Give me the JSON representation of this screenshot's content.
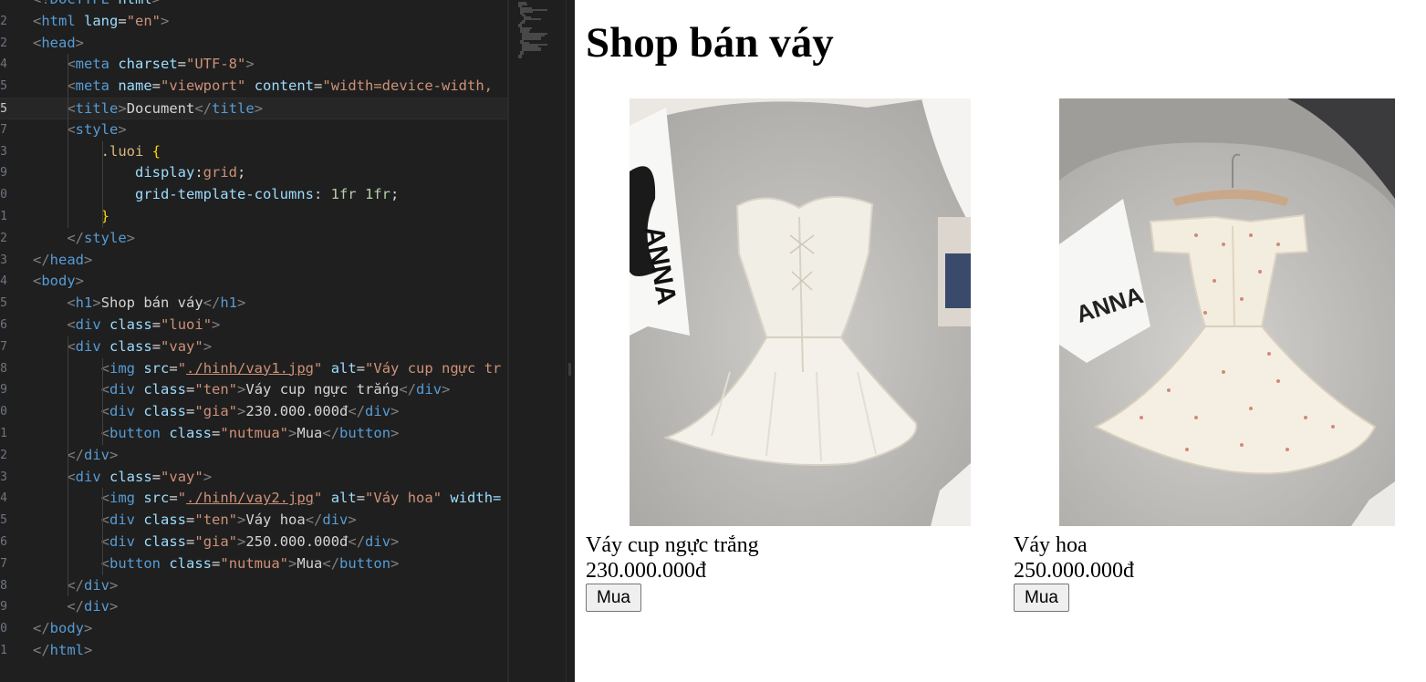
{
  "editor": {
    "lines": [
      {
        "n": "",
        "tokens": [
          [
            "b",
            "<!"
          ],
          [
            "tag",
            "DOCTYPE"
          ],
          [
            "txt",
            " "
          ],
          [
            "attr",
            "html"
          ],
          [
            "b",
            ">"
          ]
        ]
      },
      {
        "n": "2",
        "tokens": [
          [
            "b",
            "<"
          ],
          [
            "tag",
            "html"
          ],
          [
            "txt",
            " "
          ],
          [
            "attr",
            "lang"
          ],
          [
            "txt",
            "="
          ],
          [
            "str",
            "\"en\""
          ],
          [
            "b",
            ">"
          ]
        ]
      },
      {
        "n": "2",
        "tokens": [
          [
            "b",
            "<"
          ],
          [
            "tag",
            "head"
          ],
          [
            "b",
            ">"
          ]
        ]
      },
      {
        "n": "4",
        "tokens": [
          [
            "txt",
            "    "
          ],
          [
            "b",
            "<"
          ],
          [
            "tag",
            "meta"
          ],
          [
            "txt",
            " "
          ],
          [
            "attr",
            "charset"
          ],
          [
            "txt",
            "="
          ],
          [
            "str",
            "\"UTF-8\""
          ],
          [
            "b",
            ">"
          ]
        ]
      },
      {
        "n": "5",
        "tokens": [
          [
            "txt",
            "    "
          ],
          [
            "b",
            "<"
          ],
          [
            "tag",
            "meta"
          ],
          [
            "txt",
            " "
          ],
          [
            "attr",
            "name"
          ],
          [
            "txt",
            "="
          ],
          [
            "str",
            "\"viewport\""
          ],
          [
            "txt",
            " "
          ],
          [
            "attr",
            "content"
          ],
          [
            "txt",
            "="
          ],
          [
            "str",
            "\"width=device-width,"
          ]
        ]
      },
      {
        "n": "5",
        "tokens": [
          [
            "txt",
            "    "
          ],
          [
            "b",
            "<"
          ],
          [
            "tag",
            "title"
          ],
          [
            "b",
            ">"
          ],
          [
            "txt",
            "Document"
          ],
          [
            "b",
            "</"
          ],
          [
            "tag",
            "title"
          ],
          [
            "b",
            ">"
          ]
        ]
      },
      {
        "n": "7",
        "tokens": [
          [
            "txt",
            "    "
          ],
          [
            "b",
            "<"
          ],
          [
            "tag",
            "style"
          ],
          [
            "b",
            ">"
          ]
        ]
      },
      {
        "n": "3",
        "tokens": [
          [
            "txt",
            "        "
          ],
          [
            "sel",
            ".luoi"
          ],
          [
            "txt",
            " "
          ],
          [
            "brace",
            "{"
          ]
        ]
      },
      {
        "n": "9",
        "tokens": [
          [
            "txt",
            "            "
          ],
          [
            "prop",
            "display"
          ],
          [
            "txt",
            ":"
          ],
          [
            "val",
            "grid"
          ],
          [
            "txt",
            ";"
          ]
        ]
      },
      {
        "n": "0",
        "tokens": [
          [
            "txt",
            "            "
          ],
          [
            "prop",
            "grid-template-columns"
          ],
          [
            "txt",
            ": "
          ],
          [
            "num",
            "1fr"
          ],
          [
            "txt",
            " "
          ],
          [
            "num",
            "1fr"
          ],
          [
            "txt",
            ";"
          ]
        ]
      },
      {
        "n": "1",
        "tokens": [
          [
            "txt",
            "        "
          ],
          [
            "brace",
            "}"
          ]
        ]
      },
      {
        "n": "2",
        "tokens": [
          [
            "txt",
            "    "
          ],
          [
            "b",
            "</"
          ],
          [
            "tag",
            "style"
          ],
          [
            "b",
            ">"
          ]
        ]
      },
      {
        "n": "3",
        "tokens": [
          [
            "b",
            "</"
          ],
          [
            "tag",
            "head"
          ],
          [
            "b",
            ">"
          ]
        ]
      },
      {
        "n": "4",
        "tokens": [
          [
            "b",
            "<"
          ],
          [
            "tag",
            "body"
          ],
          [
            "b",
            ">"
          ]
        ]
      },
      {
        "n": "5",
        "tokens": [
          [
            "txt",
            "    "
          ],
          [
            "b",
            "<"
          ],
          [
            "tag",
            "h1"
          ],
          [
            "b",
            ">"
          ],
          [
            "txt",
            "Shop bán váy"
          ],
          [
            "b",
            "</"
          ],
          [
            "tag",
            "h1"
          ],
          [
            "b",
            ">"
          ]
        ]
      },
      {
        "n": "6",
        "tokens": [
          [
            "txt",
            "    "
          ],
          [
            "b",
            "<"
          ],
          [
            "tag",
            "div"
          ],
          [
            "txt",
            " "
          ],
          [
            "attr",
            "class"
          ],
          [
            "txt",
            "="
          ],
          [
            "str",
            "\"luoi\""
          ],
          [
            "b",
            ">"
          ]
        ]
      },
      {
        "n": "7",
        "tokens": [
          [
            "txt",
            "    "
          ],
          [
            "b",
            "<"
          ],
          [
            "tag",
            "div"
          ],
          [
            "txt",
            " "
          ],
          [
            "attr",
            "class"
          ],
          [
            "txt",
            "="
          ],
          [
            "str",
            "\"vay\""
          ],
          [
            "b",
            ">"
          ]
        ]
      },
      {
        "n": "8",
        "tokens": [
          [
            "txt",
            "        "
          ],
          [
            "b",
            "<"
          ],
          [
            "tag",
            "img"
          ],
          [
            "txt",
            " "
          ],
          [
            "attr",
            "src"
          ],
          [
            "txt",
            "="
          ],
          [
            "str",
            "\""
          ],
          [
            "link",
            "./hinh/vay1.jpg"
          ],
          [
            "str",
            "\""
          ],
          [
            "txt",
            " "
          ],
          [
            "attr",
            "alt"
          ],
          [
            "txt",
            "="
          ],
          [
            "str",
            "\"Váy cup ngực tr"
          ]
        ]
      },
      {
        "n": "9",
        "tokens": [
          [
            "txt",
            "        "
          ],
          [
            "b",
            "<"
          ],
          [
            "tag",
            "div"
          ],
          [
            "txt",
            " "
          ],
          [
            "attr",
            "class"
          ],
          [
            "txt",
            "="
          ],
          [
            "str",
            "\"ten\""
          ],
          [
            "b",
            ">"
          ],
          [
            "txt",
            "Váy cup ngực trắng"
          ],
          [
            "b",
            "</"
          ],
          [
            "tag",
            "div"
          ],
          [
            "b",
            ">"
          ]
        ]
      },
      {
        "n": "0",
        "tokens": [
          [
            "txt",
            "        "
          ],
          [
            "b",
            "<"
          ],
          [
            "tag",
            "div"
          ],
          [
            "txt",
            " "
          ],
          [
            "attr",
            "class"
          ],
          [
            "txt",
            "="
          ],
          [
            "str",
            "\"gia\""
          ],
          [
            "b",
            ">"
          ],
          [
            "txt",
            "230.000.000đ"
          ],
          [
            "b",
            "</"
          ],
          [
            "tag",
            "div"
          ],
          [
            "b",
            ">"
          ]
        ]
      },
      {
        "n": "1",
        "tokens": [
          [
            "txt",
            "        "
          ],
          [
            "b",
            "<"
          ],
          [
            "tag",
            "button"
          ],
          [
            "txt",
            " "
          ],
          [
            "attr",
            "class"
          ],
          [
            "txt",
            "="
          ],
          [
            "str",
            "\"nutmua\""
          ],
          [
            "b",
            ">"
          ],
          [
            "txt",
            "Mua"
          ],
          [
            "b",
            "</"
          ],
          [
            "tag",
            "button"
          ],
          [
            "b",
            ">"
          ]
        ]
      },
      {
        "n": "2",
        "tokens": [
          [
            "txt",
            "    "
          ],
          [
            "b",
            "</"
          ],
          [
            "tag",
            "div"
          ],
          [
            "b",
            ">"
          ]
        ]
      },
      {
        "n": "3",
        "tokens": [
          [
            "txt",
            "    "
          ],
          [
            "b",
            "<"
          ],
          [
            "tag",
            "div"
          ],
          [
            "txt",
            " "
          ],
          [
            "attr",
            "class"
          ],
          [
            "txt",
            "="
          ],
          [
            "str",
            "\"vay\""
          ],
          [
            "b",
            ">"
          ]
        ]
      },
      {
        "n": "4",
        "tokens": [
          [
            "txt",
            "        "
          ],
          [
            "b",
            "<"
          ],
          [
            "tag",
            "img"
          ],
          [
            "txt",
            " "
          ],
          [
            "attr",
            "src"
          ],
          [
            "txt",
            "="
          ],
          [
            "str",
            "\""
          ],
          [
            "link",
            "./hinh/vay2.jpg"
          ],
          [
            "str",
            "\""
          ],
          [
            "txt",
            " "
          ],
          [
            "attr",
            "alt"
          ],
          [
            "txt",
            "="
          ],
          [
            "str",
            "\"Váy hoa\""
          ],
          [
            "txt",
            " "
          ],
          [
            "attr",
            "width="
          ]
        ]
      },
      {
        "n": "5",
        "tokens": [
          [
            "txt",
            "        "
          ],
          [
            "b",
            "<"
          ],
          [
            "tag",
            "div"
          ],
          [
            "txt",
            " "
          ],
          [
            "attr",
            "class"
          ],
          [
            "txt",
            "="
          ],
          [
            "str",
            "\"ten\""
          ],
          [
            "b",
            ">"
          ],
          [
            "txt",
            "Váy hoa"
          ],
          [
            "b",
            "</"
          ],
          [
            "tag",
            "div"
          ],
          [
            "b",
            ">"
          ]
        ]
      },
      {
        "n": "6",
        "tokens": [
          [
            "txt",
            "        "
          ],
          [
            "b",
            "<"
          ],
          [
            "tag",
            "div"
          ],
          [
            "txt",
            " "
          ],
          [
            "attr",
            "class"
          ],
          [
            "txt",
            "="
          ],
          [
            "str",
            "\"gia\""
          ],
          [
            "b",
            ">"
          ],
          [
            "txt",
            "250.000.000đ"
          ],
          [
            "b",
            "</"
          ],
          [
            "tag",
            "div"
          ],
          [
            "b",
            ">"
          ]
        ]
      },
      {
        "n": "7",
        "tokens": [
          [
            "txt",
            "        "
          ],
          [
            "b",
            "<"
          ],
          [
            "tag",
            "button"
          ],
          [
            "txt",
            " "
          ],
          [
            "attr",
            "class"
          ],
          [
            "txt",
            "="
          ],
          [
            "str",
            "\"nutmua\""
          ],
          [
            "b",
            ">"
          ],
          [
            "txt",
            "Mua"
          ],
          [
            "b",
            "</"
          ],
          [
            "tag",
            "button"
          ],
          [
            "b",
            ">"
          ]
        ]
      },
      {
        "n": "8",
        "tokens": [
          [
            "txt",
            "    "
          ],
          [
            "b",
            "</"
          ],
          [
            "tag",
            "div"
          ],
          [
            "b",
            ">"
          ]
        ]
      },
      {
        "n": "9",
        "tokens": [
          [
            "txt",
            "    "
          ],
          [
            "b",
            "</"
          ],
          [
            "tag",
            "div"
          ],
          [
            "b",
            ">"
          ]
        ]
      },
      {
        "n": "0",
        "tokens": [
          [
            "b",
            "</"
          ],
          [
            "tag",
            "body"
          ],
          [
            "b",
            ">"
          ]
        ]
      },
      {
        "n": "1",
        "tokens": [
          [
            "b",
            "</"
          ],
          [
            "tag",
            "html"
          ],
          [
            "b",
            ">"
          ]
        ]
      }
    ],
    "active_line": 5,
    "colors": {
      "background": "#1f1f1f",
      "tag": "#569cd6",
      "attribute": "#9cdcfe",
      "string": "#ce9178",
      "text": "#d4d4d4"
    }
  },
  "preview": {
    "title": "Shop bán váy",
    "products": [
      {
        "name": "Váy cup ngực trắng",
        "price": "230.000.000đ",
        "buy_label": "Mua",
        "image_alt": "white corset dress photo"
      },
      {
        "name": "Váy hoa",
        "price": "250.000.000đ",
        "buy_label": "Mua",
        "image_alt": "floral off-shoulder dress photo"
      }
    ]
  }
}
